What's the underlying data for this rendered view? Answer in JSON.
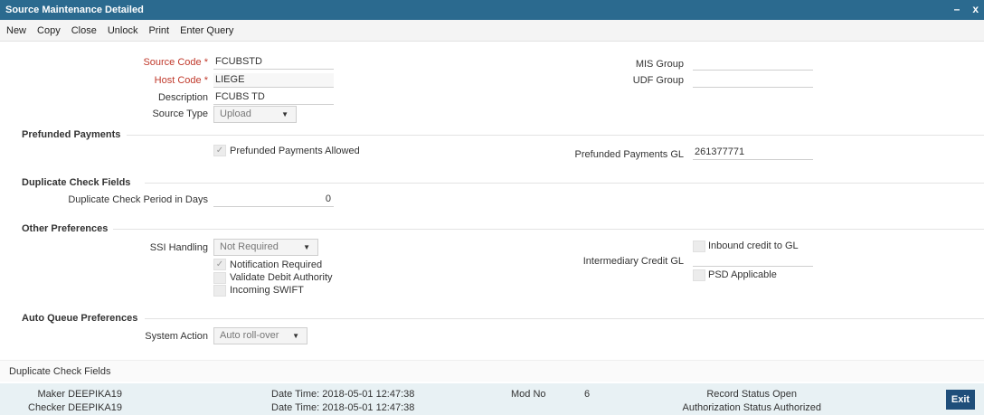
{
  "window": {
    "title": "Source Maintenance Detailed",
    "minimize": "–",
    "close": "x"
  },
  "menu": [
    "New",
    "Copy",
    "Close",
    "Unlock",
    "Print",
    "Enter Query"
  ],
  "form": {
    "source_code": {
      "label": "Source Code",
      "required": "*",
      "value": "FCUBSTD"
    },
    "host_code": {
      "label": "Host Code",
      "required": "*",
      "value": "LIEGE"
    },
    "description": {
      "label": "Description",
      "value": "FCUBS TD"
    },
    "source_type": {
      "label": "Source Type",
      "value": "Upload"
    },
    "mis_group": {
      "label": "MIS Group",
      "value": ""
    },
    "udf_group": {
      "label": "UDF Group",
      "value": ""
    }
  },
  "prefunded": {
    "section": "Prefunded Payments",
    "allowed_label": "Prefunded Payments Allowed",
    "allowed_checked": true,
    "gl_label": "Prefunded Payments GL",
    "gl_value": "261377771"
  },
  "duplicate": {
    "section": "Duplicate Check Fields",
    "period_label": "Duplicate Check Period in Days",
    "period_value": "0"
  },
  "other": {
    "section": "Other Preferences",
    "ssi_label": "SSI Handling",
    "ssi_value": "Not Required",
    "notification_label": "Notification Required",
    "notification_checked": true,
    "validate_label": "Validate Debit Authority",
    "validate_checked": false,
    "swift_label": "Incoming SWIFT",
    "swift_checked": false,
    "intermediary_label": "Intermediary Credit GL",
    "inbound_label": "Inbound credit to GL",
    "inbound_checked": false,
    "psd_label": "PSD Applicable",
    "psd_checked": false
  },
  "auto_queue": {
    "section": "Auto Queue Preferences",
    "action_label": "System Action",
    "action_value": "Auto roll-over"
  },
  "subscreen": "Duplicate Check Fields",
  "audit": {
    "maker_label": "Maker",
    "maker_value": "DEEPIKA19",
    "checker_label": "Checker",
    "checker_value": "DEEPIKA19",
    "date1_label": "Date Time:",
    "date1_value": "2018-05-01 12:47:38",
    "date2_label": "Date Time:",
    "date2_value": "2018-05-01 12:47:38",
    "mod_label": "Mod No",
    "mod_value": "6",
    "record_label": "Record Status",
    "record_value": "Open",
    "auth_label": "Authorization Status",
    "auth_value": "Authorized",
    "exit_label": "Exit"
  },
  "icons": {
    "check": "checkmark-icon",
    "dropdown": "chevron-down-icon"
  },
  "colors": {
    "titlebar": "#2b6a8f",
    "required": "#c0392b",
    "footer": "#e8f1f4",
    "exit": "#1f4e7a"
  }
}
